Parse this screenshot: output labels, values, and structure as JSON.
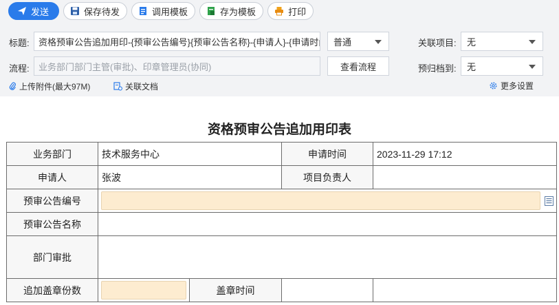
{
  "toolbar": {
    "send": "发送",
    "save_draft": "保存待发",
    "use_template": "调用模板",
    "save_template": "存为模板",
    "print": "打印"
  },
  "header_form": {
    "title_label": "标题:",
    "title_value": "资格预审公告追加用印-{预审公告编号}{预审公告名称}-{申请人}-{申请时间}",
    "priority_value": "普通",
    "related_project_label": "关联项目:",
    "related_project_value": "无",
    "flow_label": "流程:",
    "flow_placeholder": "业务部门部门主管(审批)、印章管理员(协同)",
    "view_flow_button": "查看流程",
    "archive_label": "预归档到:",
    "archive_value": "无",
    "upload_attachment": "上传附件(最大97M)",
    "related_document": "关联文档",
    "more_settings": "更多设置"
  },
  "form": {
    "title": "资格预审公告追加用印表",
    "rows": {
      "dept_label": "业务部门",
      "dept_value": "技术服务中心",
      "apply_time_label": "申请时间",
      "apply_time_value": "2023-11-29 17:12",
      "applicant_label": "申请人",
      "applicant_value": "张波",
      "project_owner_label": "项目负责人",
      "project_owner_value": "",
      "notice_no_label": "预审公告编号",
      "notice_name_label": "预审公告名称",
      "dept_approval_label": "部门审批",
      "extra_copies_label": "追加盖章份数",
      "stamp_time_label": "盖章时间"
    }
  },
  "colors": {
    "accent": "#2a7bea",
    "required_field_bg": "#fdecd0",
    "header_bg": "#f2f3f5"
  },
  "icons": {
    "send": "paper-plane-icon",
    "save": "floppy-disk-icon",
    "template": "document-icon",
    "save_template": "document-save-icon",
    "print": "printer-icon",
    "attachment": "paperclip-icon",
    "related_doc": "linked-document-icon",
    "settings": "gear-icon",
    "lookup": "table-lookup-icon"
  }
}
